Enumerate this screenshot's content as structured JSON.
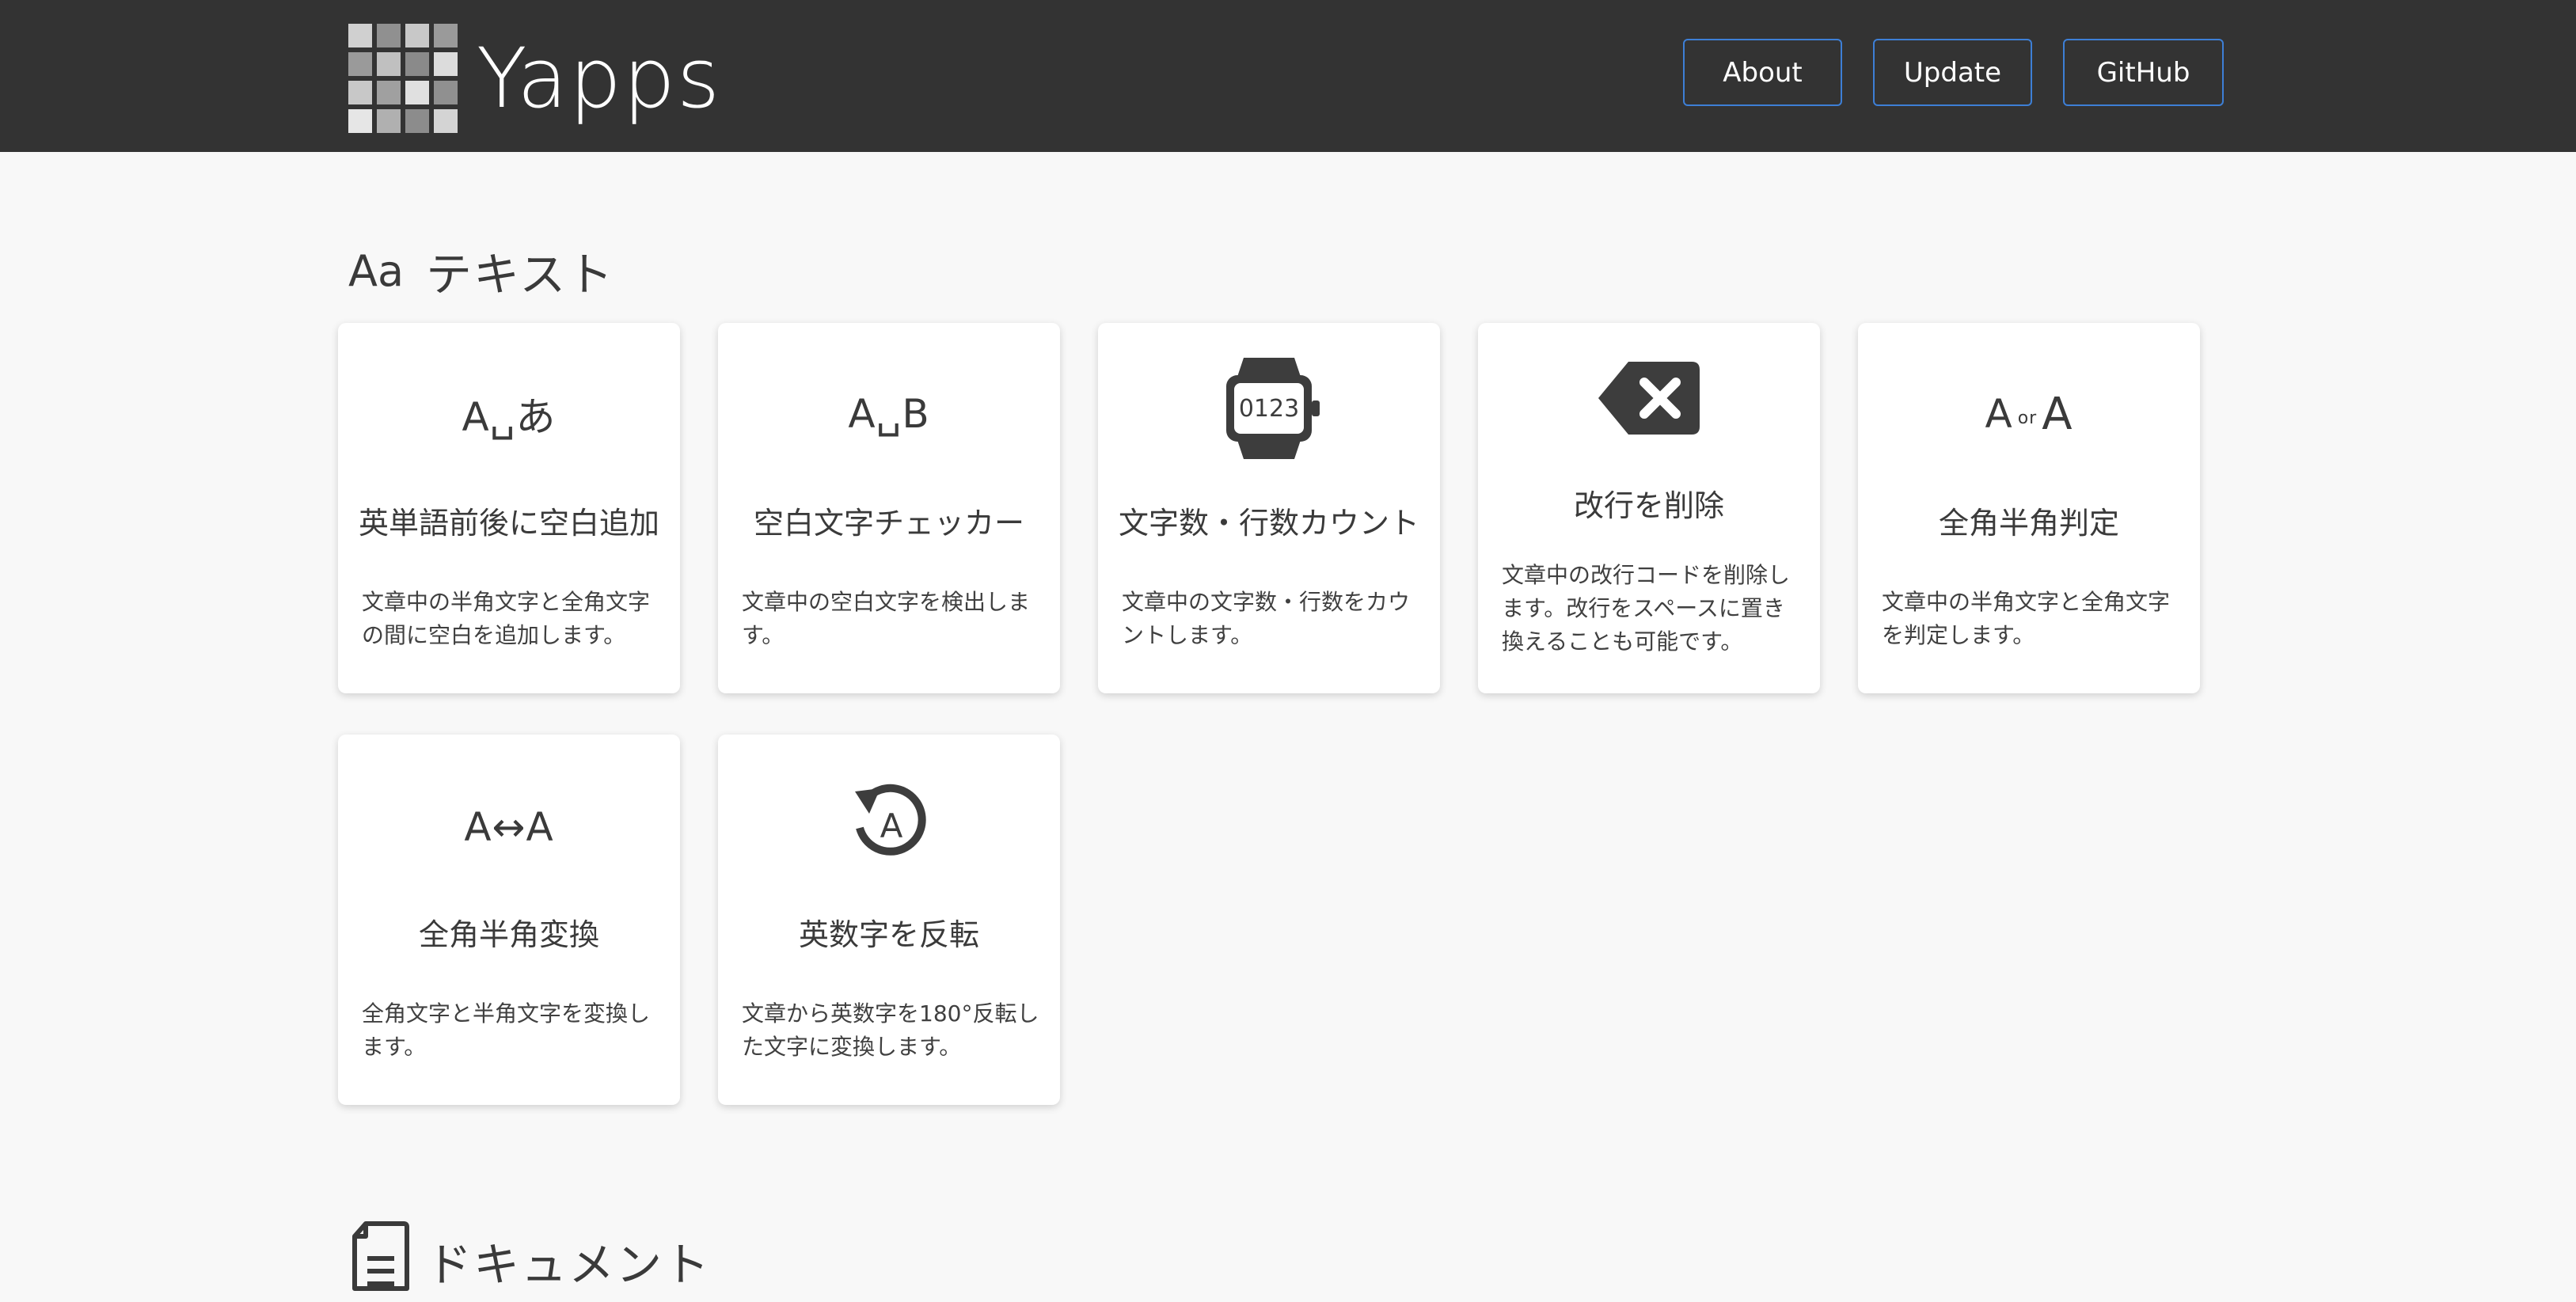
{
  "header": {
    "brand": "Yapps",
    "nav": [
      {
        "label": "About"
      },
      {
        "label": "Update"
      },
      {
        "label": "GitHub"
      }
    ]
  },
  "sections": [
    {
      "icon_text": "Aa",
      "title": "テキスト",
      "cards": [
        {
          "icon": "space-insert-icon",
          "icon_text": "A␣あ",
          "title": "英単語前後に空白追加",
          "desc": "文章中の半角文字と全角文字の間に空白を追加します。"
        },
        {
          "icon": "space-checker-icon",
          "icon_text": "A␣B",
          "title": "空白文字チェッカー",
          "desc": "文章中の空白文字を検出します。"
        },
        {
          "icon": "counter-watch-icon",
          "icon_text": "0123",
          "title": "文字数・行数カウント",
          "desc": "文章中の文字数・行数をカウントします。"
        },
        {
          "icon": "backspace-icon",
          "title": "改行を削除",
          "desc": "文章中の改行コードを削除します。改行をスペースに置き換えることも可能です。"
        },
        {
          "icon": "width-judge-icon",
          "icon_left": "A",
          "icon_mid": "or",
          "icon_right": "A",
          "title": "全角半角判定",
          "desc": "文章中の半角文字と全角文字を判定します。"
        },
        {
          "icon": "width-convert-icon",
          "icon_text": "A↔A",
          "title": "全角半角変換",
          "desc": "全角文字と半角文字を変換します。"
        },
        {
          "icon": "rotate-icon",
          "icon_text": "A",
          "title": "英数字を反転",
          "desc": "文章から英数字を180°反転した文字に変換します。"
        }
      ]
    },
    {
      "icon": "document-icon",
      "title": "ドキュメント"
    }
  ],
  "colors": {
    "topbar": "#333333",
    "nav_border": "#3d7fd6",
    "page_bg": "#f8f8f8",
    "card_bg": "#ffffff"
  }
}
